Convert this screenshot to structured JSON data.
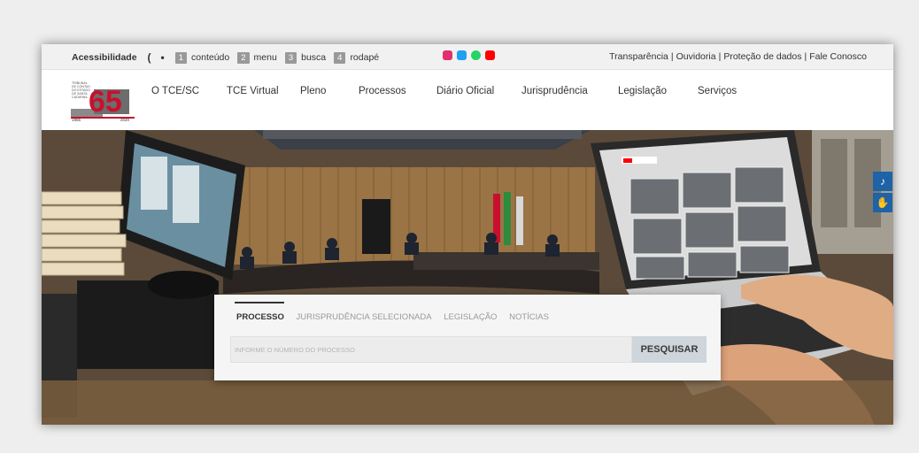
{
  "topbar": {
    "accessibility_label": "Acessibilidade",
    "contrast_glyph": "(",
    "audio_glyph": "•",
    "shortcuts": [
      {
        "key": "1",
        "label": "conteúdo"
      },
      {
        "key": "2",
        "label": "menu"
      },
      {
        "key": "3",
        "label": "busca"
      },
      {
        "key": "4",
        "label": "rodapé"
      }
    ],
    "social_icons": [
      {
        "name": "instagram-icon",
        "color": "#e1306c"
      },
      {
        "name": "twitter-icon",
        "color": "#1da1f2"
      },
      {
        "name": "whatsapp-icon",
        "color": "#25d366"
      },
      {
        "name": "youtube-icon",
        "color": "#ff0000"
      }
    ],
    "links": [
      "Transparência",
      "Ouvidoria",
      "Proteção de dados",
      "Fale Conosco"
    ],
    "separator": "|"
  },
  "nav": {
    "logo": {
      "number": "65",
      "years_left": "1955",
      "years_right": "2020",
      "text": "TRIBUNAL DE CONTAS DO ESTADO DE SANTA CATARINA"
    },
    "items": [
      "O TCE/SC",
      "TCE Virtual",
      "Pleno",
      "Processos",
      "Diário Oficial",
      "Jurisprudência",
      "Legislação",
      "Serviços"
    ]
  },
  "hero": {
    "side_buttons": [
      {
        "name": "audio-reader-icon",
        "glyph": "👂"
      },
      {
        "name": "sign-language-icon",
        "glyph": "✋"
      }
    ],
    "laptop_screen": {
      "app": "YouTube",
      "search_placeholder": "Pesquisa"
    }
  },
  "search": {
    "tabs": [
      "PROCESSO",
      "JURISPRUDÊNCIA SELECIONADA",
      "LEGISLAÇÃO",
      "NOTÍCIAS"
    ],
    "active_tab_index": 0,
    "placeholder": "INFORME O NÚMERO DO PROCESSO",
    "button_label": "PESQUISAR"
  },
  "colors": {
    "accent_blue": "#1f63a7",
    "button_bg": "#ced6dc",
    "logo_red": "#c8102e"
  }
}
